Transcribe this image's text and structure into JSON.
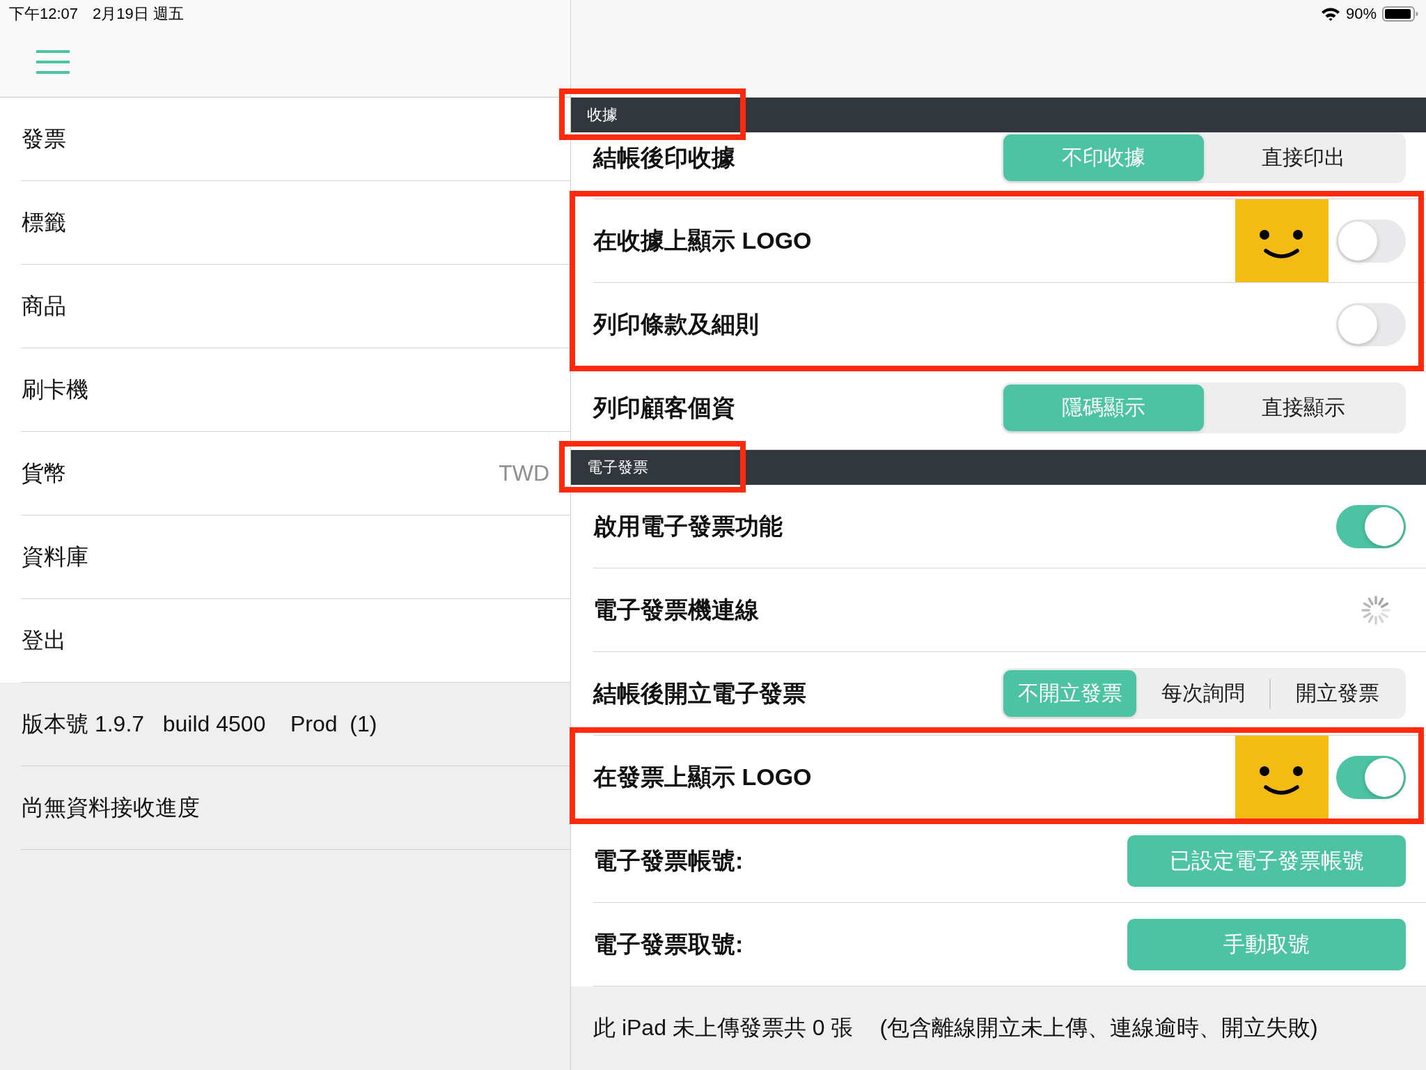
{
  "status_bar": {
    "time": "下午12:07",
    "date": "2月19日 週五",
    "battery": "90%"
  },
  "sidebar": {
    "items": [
      {
        "label": "發票"
      },
      {
        "label": "標籤"
      },
      {
        "label": "商品"
      },
      {
        "label": "刷卡機"
      },
      {
        "label": "貨幣",
        "value": "TWD"
      },
      {
        "label": "資料庫"
      },
      {
        "label": "登出"
      }
    ],
    "info": [
      "版本號 1.9.7   build 4500    Prod  (1)",
      "尚無資料接收進度"
    ]
  },
  "settings": {
    "sections": [
      {
        "title": "收據",
        "highlighted": true,
        "rows": [
          {
            "kind": "segmented",
            "label": "結帳後印收據",
            "highlighted": false,
            "options": [
              {
                "label": "不印收據",
                "selected": true
              },
              {
                "label": "直接印出",
                "selected": false
              }
            ]
          },
          {
            "kind": "toggle",
            "label": "在收據上顯示 LOGO",
            "highlighted": true,
            "logo": true,
            "on": false
          },
          {
            "kind": "toggle",
            "label": "列印條款及細則",
            "highlighted": true,
            "on": false
          },
          {
            "kind": "segmented",
            "label": "列印顧客個資",
            "highlighted": false,
            "options": [
              {
                "label": "隱碼顯示",
                "selected": true
              },
              {
                "label": "直接顯示",
                "selected": false
              }
            ]
          }
        ]
      },
      {
        "title": "電子發票",
        "highlighted": true,
        "rows": [
          {
            "kind": "toggle",
            "label": "啟用電子發票功能",
            "highlighted": false,
            "on": true
          },
          {
            "kind": "loading",
            "label": "電子發票機連線",
            "highlighted": false
          },
          {
            "kind": "segmented",
            "label": "結帳後開立電子發票",
            "highlighted": false,
            "options": [
              {
                "label": "不開立發票",
                "selected": true
              },
              {
                "label": "每次詢問",
                "selected": false
              },
              {
                "label": "開立發票",
                "selected": false
              }
            ]
          },
          {
            "kind": "toggle",
            "label": "在發票上顯示 LOGO",
            "highlighted": true,
            "logo": true,
            "on": true
          },
          {
            "kind": "button",
            "label": "電子發票帳號:",
            "highlighted": false,
            "button": "已設定電子發票帳號"
          },
          {
            "kind": "button",
            "label": "電子發票取號:",
            "highlighted": false,
            "button": "手動取號"
          }
        ]
      }
    ],
    "footer": {
      "count": "此 iPad 未上傳發票共 0 張",
      "note": "(包含離線開立未上傳、連線逾時、開立失敗)"
    }
  }
}
